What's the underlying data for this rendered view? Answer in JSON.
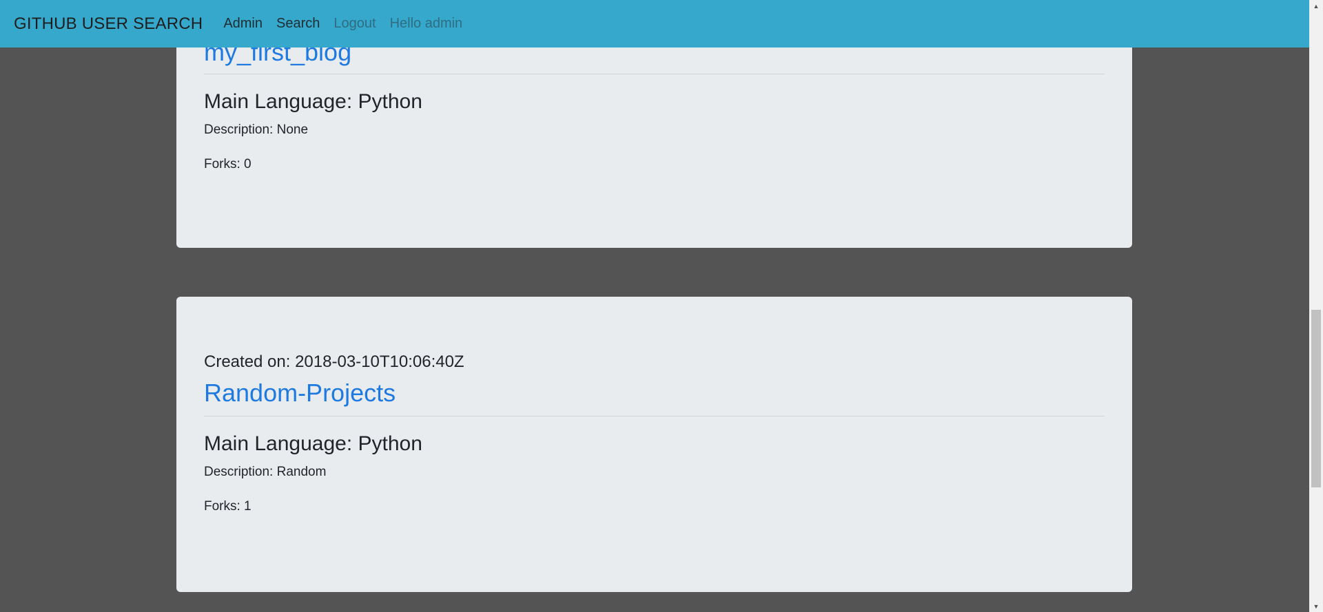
{
  "navbar": {
    "brand": "GITHUB USER SEARCH",
    "links": [
      {
        "label": "Admin"
      },
      {
        "label": "Search"
      },
      {
        "label": "Logout"
      }
    ],
    "greeting": "Hello admin"
  },
  "repos": [
    {
      "created": "",
      "name": "my_first_blog",
      "language": "Main Language: Python",
      "description": "Description: None",
      "forks": "Forks: 0"
    },
    {
      "created": "Created on: 2018-03-10T10:06:40Z",
      "name": "Random-Projects",
      "language": "Main Language: Python",
      "description": "Description: Random",
      "forks": "Forks: 1"
    }
  ],
  "scrollbar": {
    "up_arrow": "▲",
    "down_arrow": "▼"
  }
}
